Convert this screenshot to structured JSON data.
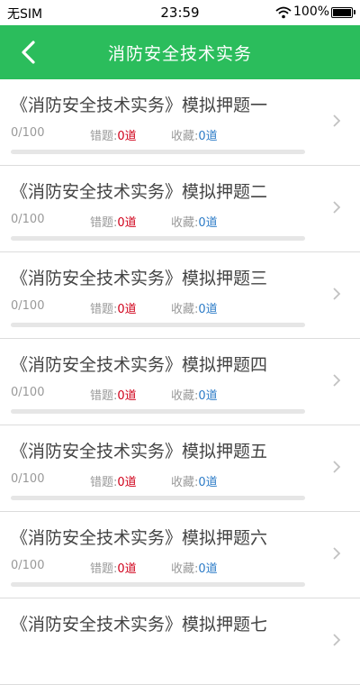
{
  "status_bar": {
    "carrier": "无SIM",
    "time": "23:59",
    "battery": "100%"
  },
  "header": {
    "title": "消防安全技术实务"
  },
  "colors": {
    "accent": "#2bbd5c",
    "wrong": "#d0021b",
    "favorite": "#2d7cc7"
  },
  "labels": {
    "wrong": "错题:",
    "favorite": "收藏:"
  },
  "items": [
    {
      "title": "《消防安全技术实务》模拟押题一",
      "progress": "0/100",
      "progress_fraction": 0,
      "wrong": "0道",
      "favorite": "0道"
    },
    {
      "title": "《消防安全技术实务》模拟押题二",
      "progress": "0/100",
      "progress_fraction": 0,
      "wrong": "0道",
      "favorite": "0道"
    },
    {
      "title": "《消防安全技术实务》模拟押题三",
      "progress": "0/100",
      "progress_fraction": 0,
      "wrong": "0道",
      "favorite": "0道"
    },
    {
      "title": "《消防安全技术实务》模拟押题四",
      "progress": "0/100",
      "progress_fraction": 0,
      "wrong": "0道",
      "favorite": "0道"
    },
    {
      "title": "《消防安全技术实务》模拟押题五",
      "progress": "0/100",
      "progress_fraction": 0,
      "wrong": "0道",
      "favorite": "0道"
    },
    {
      "title": "《消防安全技术实务》模拟押题六",
      "progress": "0/100",
      "progress_fraction": 0,
      "wrong": "0道",
      "favorite": "0道"
    },
    {
      "title": "《消防安全技术实务》模拟押题七",
      "progress": "",
      "progress_fraction": 0,
      "wrong": "",
      "favorite": ""
    }
  ]
}
